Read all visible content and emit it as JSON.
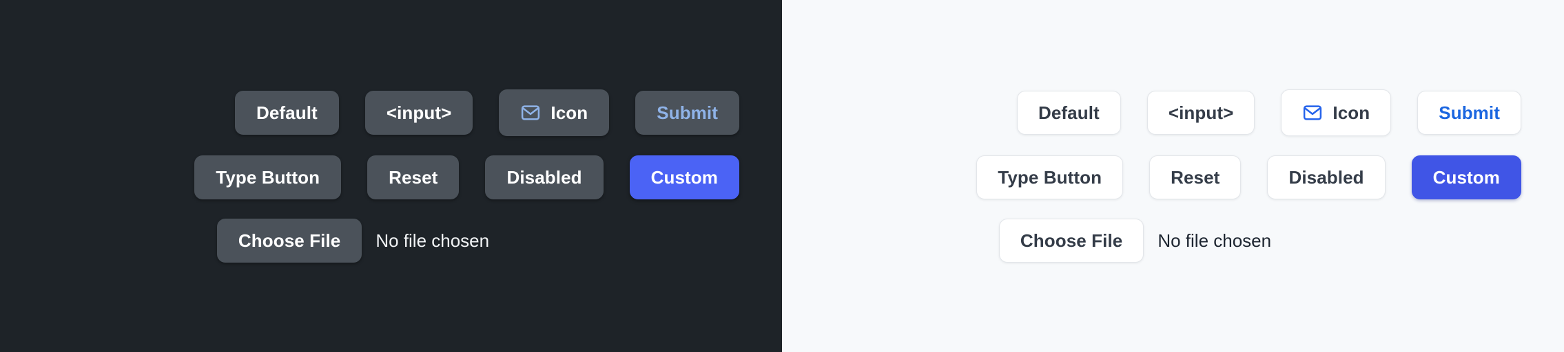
{
  "panels": [
    {
      "theme": "dark",
      "background": "#1e2328",
      "button_background": "#4b525a",
      "text_color": "#ffffff",
      "accent_color": "#8fb3e8",
      "custom_color": "#4b63f5",
      "rows": [
        {
          "buttons": [
            {
              "label": "Default",
              "kind": "default"
            },
            {
              "label": "<input>",
              "kind": "default"
            },
            {
              "label": "Icon",
              "kind": "icon",
              "icon": "mail-icon"
            },
            {
              "label": "Submit",
              "kind": "link"
            }
          ]
        },
        {
          "buttons": [
            {
              "label": "Type Button",
              "kind": "default"
            },
            {
              "label": "Reset",
              "kind": "default"
            },
            {
              "label": "Disabled",
              "kind": "disabled"
            },
            {
              "label": "Custom",
              "kind": "custom"
            }
          ]
        }
      ],
      "file": {
        "button_label": "Choose File",
        "status": "No file chosen"
      }
    },
    {
      "theme": "light",
      "background": "#f7f9fb",
      "button_background": "#ffffff",
      "text_color": "#343c48",
      "accent_color": "#1b66e0",
      "custom_color": "#4055e6",
      "rows": [
        {
          "buttons": [
            {
              "label": "Default",
              "kind": "default"
            },
            {
              "label": "<input>",
              "kind": "default"
            },
            {
              "label": "Icon",
              "kind": "icon",
              "icon": "mail-icon"
            },
            {
              "label": "Submit",
              "kind": "link"
            }
          ]
        },
        {
          "buttons": [
            {
              "label": "Type Button",
              "kind": "default"
            },
            {
              "label": "Reset",
              "kind": "default"
            },
            {
              "label": "Disabled",
              "kind": "disabled"
            },
            {
              "label": "Custom",
              "kind": "custom"
            }
          ]
        }
      ],
      "file": {
        "button_label": "Choose File",
        "status": "No file chosen"
      }
    }
  ]
}
